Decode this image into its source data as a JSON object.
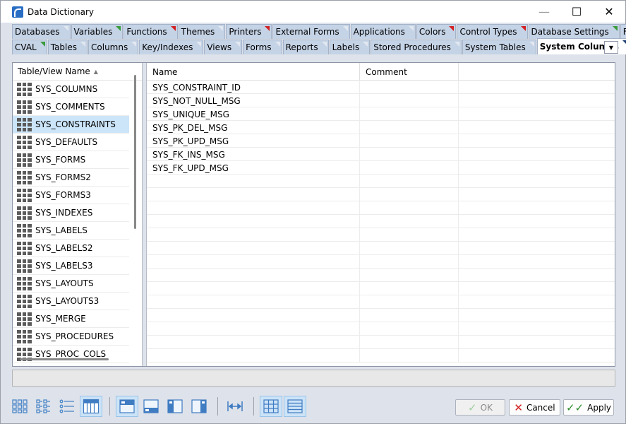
{
  "window": {
    "title": "Data Dictionary"
  },
  "tabs": {
    "row1": [
      {
        "label": "Databases",
        "flag": "plain"
      },
      {
        "label": "Variables",
        "flag": "green"
      },
      {
        "label": "Functions",
        "flag": "red"
      },
      {
        "label": "Themes",
        "flag": "plain"
      },
      {
        "label": "Printers",
        "flag": "red"
      },
      {
        "label": "External Forms",
        "flag": "plain"
      },
      {
        "label": "Applications",
        "flag": "plain"
      },
      {
        "label": "Colors",
        "flag": "red"
      },
      {
        "label": "Control Types",
        "flag": "red"
      },
      {
        "label": "Database Settings",
        "flag": "green"
      },
      {
        "label": "Files",
        "flag": "plain"
      }
    ],
    "row2": [
      {
        "label": "CVAL",
        "flag": "green"
      },
      {
        "label": "Tables",
        "flag": "plain"
      },
      {
        "label": "Columns",
        "flag": "plain"
      },
      {
        "label": "Key/Indexes",
        "flag": "plain"
      },
      {
        "label": "Views",
        "flag": "plain"
      },
      {
        "label": "Forms",
        "flag": "plain"
      },
      {
        "label": "Reports",
        "flag": "plain"
      },
      {
        "label": "Labels",
        "flag": "plain"
      },
      {
        "label": "Stored Procedures",
        "flag": "plain"
      },
      {
        "label": "System Tables",
        "flag": "plain"
      },
      {
        "label": "System Columns",
        "flag": "plain",
        "active": true
      }
    ]
  },
  "left": {
    "header": "Table/View Name",
    "items": [
      "SYS_COLUMNS",
      "SYS_COMMENTS",
      "SYS_CONSTRAINTS",
      "SYS_DEFAULTS",
      "SYS_FORMS",
      "SYS_FORMS2",
      "SYS_FORMS3",
      "SYS_INDEXES",
      "SYS_LABELS",
      "SYS_LABELS2",
      "SYS_LABELS3",
      "SYS_LAYOUTS",
      "SYS_LAYOUTS3",
      "SYS_MERGE",
      "SYS_PROCEDURES",
      "SYS_PROC_COLS"
    ],
    "selected": "SYS_CONSTRAINTS"
  },
  "grid": {
    "columns": [
      "Name",
      "Comment"
    ],
    "rows": [
      "SYS_CONSTRAINT_ID",
      "SYS_NOT_NULL_MSG",
      "SYS_UNIQUE_MSG",
      "SYS_PK_DEL_MSG",
      "SYS_PK_UPD_MSG",
      "SYS_FK_INS_MSG",
      "SYS_FK_UPD_MSG"
    ],
    "empty_rows": 14
  },
  "buttons": {
    "ok": "OK",
    "cancel": "Cancel",
    "apply": "Apply"
  },
  "colors": {
    "accent": "#cce5f9",
    "tab_bg": "#c5d3e6",
    "red_flag": "#d21f1f",
    "green_flag": "#3a9b3a"
  }
}
